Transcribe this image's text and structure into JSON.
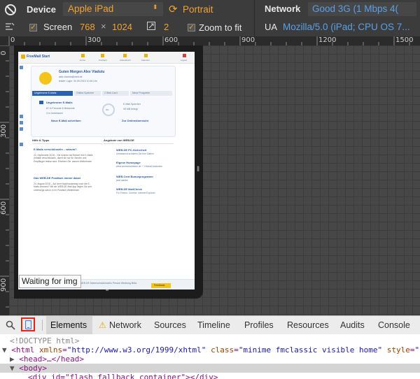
{
  "toolbar": {
    "device_label": "Device",
    "device_value": "Apple iPad",
    "orientation_label": "Portrait",
    "network_label": "Network",
    "network_value": "Good 3G (1 Mbps 4(",
    "screen_label": "Screen",
    "screen_width": "768",
    "times": "×",
    "screen_height": "1024",
    "dpr_value": "2",
    "zoom_label": "Zoom to fit",
    "ua_label": "UA",
    "ua_value": "Mozilla/5.0 (iPad; CPU OS 7..."
  },
  "ruler": {
    "top_ticks": [
      "0",
      "300",
      "600",
      "900",
      "1200",
      "1500"
    ],
    "left_ticks": [
      "0",
      "300",
      "600",
      "900"
    ]
  },
  "page": {
    "app_title": "FreeMail Start",
    "greeting": "Guten Morgen Alex Vladutu",
    "email": "alex.vladutu@web.de",
    "last_login": "letzter Login: 30.09.2015 10:46 Uhr",
    "tabs": [
      "Ungelesene E-Mails",
      "Online-Speicher",
      "2 Web.Card",
      "Neue Prospekte"
    ],
    "unread_title": "Ungelesene E-Mails",
    "unread_1": "67  in Freunde & Bekannte",
    "unread_2": "3  in Unbekannt",
    "storage_title": "E-Mail-Speicher",
    "storage_value": "95 MB belegt",
    "storage_pct": "0%",
    "new_mail": "Neue E-Mail schreiben",
    "overview": "Zur Onlineübersicht",
    "tips_title": "Hilfe & Tipps",
    "offers_title": "Angebote von WEB.DE",
    "tip1_title": "E-Mails verschlüsseln – warum?",
    "tip1_text": "22. September 2015 – Sie können bei Bedarf Ihre E-Mails (Inhalte verschlüsseln, damit sie nur für Sender und Empfänger lesbar sind. Erfahren Sie, warum Weiterlesen",
    "tip2_title": "Das WEB.DE Postfach immer dabei",
    "tip2_text": "24. August 2015 – Auf dem Nachhauseweg noch die E-Mails checken? Mit der WEB.DE Mail App liegen Sie seit unterwegs schon in Ihr Postfach Weiterlesen",
    "offer1_title": "WEB.DE PC-Sicherheit",
    "offer1_text": "Umfassend schützen Sie Ihre Daten!",
    "offer2_title": "Eigene Homepage",
    "offer2_text": "www.wunschadresse.de + 1 Monat kostenlos",
    "offer3_title": "WEB.Cent Bonusprogramm",
    "offer3_text": "jetzt starten",
    "offer4_title": "WEB.DE MailCheck",
    "offer4_text": "Für Firefox, Chrome, Internet Explorer",
    "footer": "WEB.DE  Datenschutzhinweis  Presse  Werbung  Beta",
    "feedback": "Feedback",
    "nav_icons": [
      "Home",
      "Postfach",
      "Adressbuch",
      "Kalender",
      "Logout"
    ]
  },
  "status_tooltip": "Waiting for img",
  "devtools": {
    "tabs": [
      "Elements",
      "Network",
      "Sources",
      "Timeline",
      "Profiles",
      "Resources",
      "Audits",
      "Console"
    ],
    "active_tab": "Elements"
  },
  "dom": {
    "line1": "<!DOCTYPE html>",
    "line2_tag_open": "<html",
    "line2_attr1": "xmlns",
    "line2_val1": "\"http://www.w3.org/1999/xhtml\"",
    "line2_attr2": "class",
    "line2_val2": "\"minime fmclassic visible home\"",
    "line2_attr3": "style",
    "line2_val3": "\"c",
    "line3": "<head>…</head>",
    "line4": "<body>",
    "line5": "<div id=\"flash_fallback_container\"></div>"
  }
}
